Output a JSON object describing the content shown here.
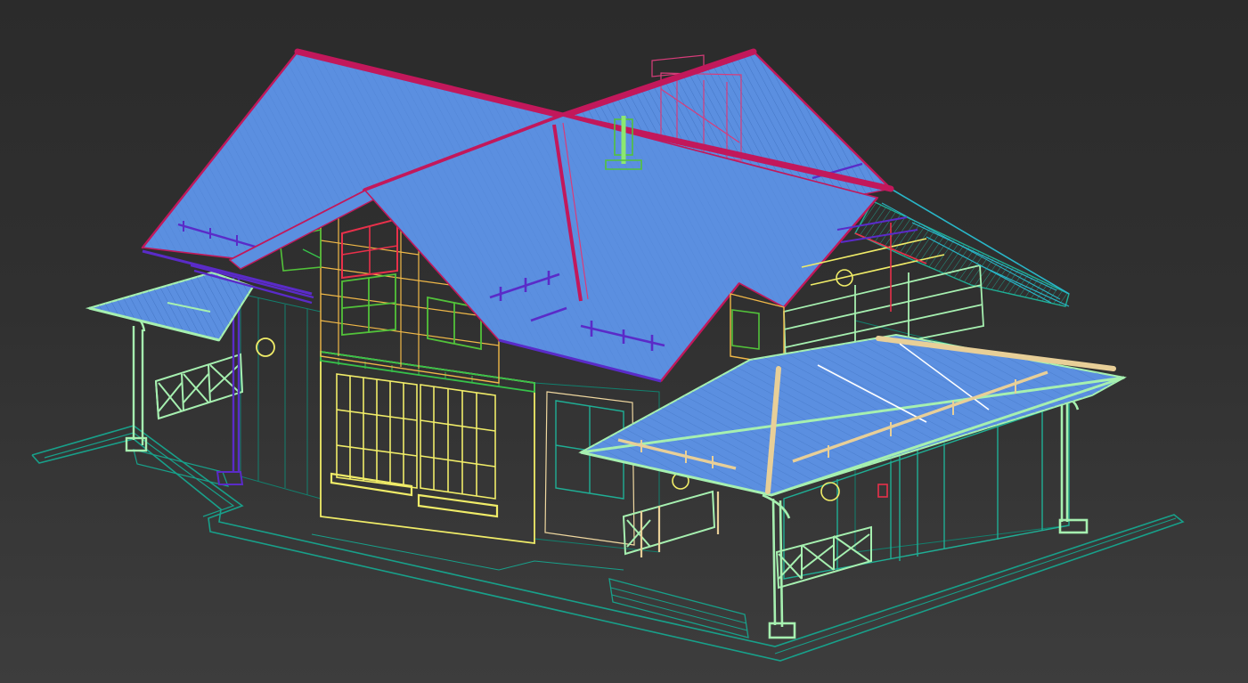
{
  "viewport": {
    "mode": "wireframe",
    "background": "#2e2e2e"
  },
  "colors": {
    "roof_fill": "#5b8fe0",
    "ridge": "#c2185b",
    "ridge_light": "#d83c7a",
    "gutter": "#5a2bc8",
    "mint": "#a6f0b0",
    "teal": "#1fae95",
    "teal_dark": "#12806e",
    "yellow": "#f0ec68",
    "orange": "#f0b848",
    "tan": "#e8cf98",
    "green": "#52c23a",
    "cyan": "#29b6c8",
    "red": "#e8304a",
    "white": "#ffffff"
  },
  "model": {
    "object": "house",
    "parts": [
      "main-roof",
      "side-roof",
      "left-porch-roof",
      "right-veranda-roof",
      "dormer",
      "chimney",
      "facade-windows",
      "porch-railings",
      "veranda-columns",
      "foundation",
      "entry-steps",
      "downpipes"
    ]
  }
}
